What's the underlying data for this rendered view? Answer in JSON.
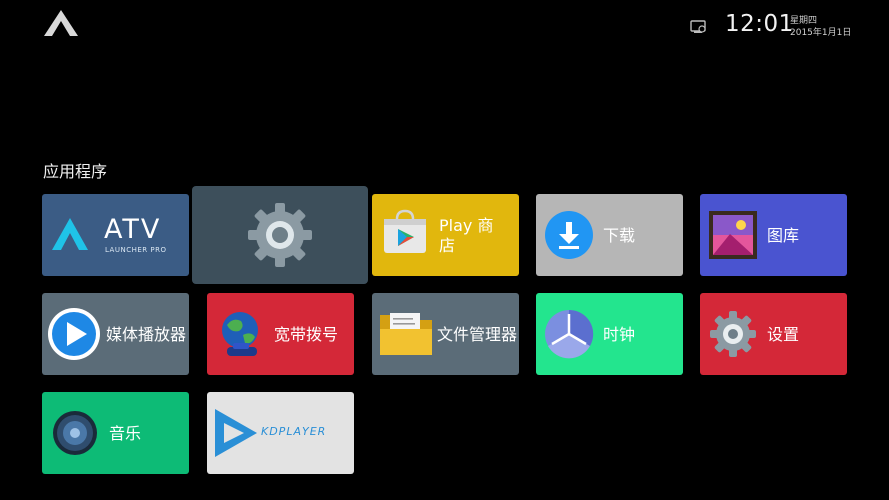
{
  "status_bar": {
    "time": "12:01",
    "weekday": "星期四",
    "date": "2015年1月1日"
  },
  "section": {
    "title": "应用程序"
  },
  "apps": {
    "atv": {
      "title": "ATV",
      "subtitle": "LAUNCHER PRO"
    },
    "play_store": {
      "line1": "Play 商",
      "line2": "店"
    },
    "download": {
      "label": "下载"
    },
    "gallery": {
      "label": "图库"
    },
    "media_player": {
      "label": "媒体播放器"
    },
    "broadband_dial": {
      "label": "宽带拨号"
    },
    "file_manager": {
      "label": "文件管理器"
    },
    "clock": {
      "label": "时钟"
    },
    "settings": {
      "label": "设置"
    },
    "music": {
      "label": "音乐"
    },
    "kdplayer": {
      "label": "KDPLAYER"
    }
  },
  "colors": {
    "background": "#000000",
    "atv": "#3b5c85",
    "focused": "#3d4f5b",
    "play_store": "#e1b70d",
    "download": "#b6b6b6",
    "gallery": "#4a54d0",
    "slate": "#5b6c78",
    "red": "#d42838",
    "clock": "#23e58e",
    "music": "#0dbb76",
    "kdplayer": "#e3e3e3"
  },
  "focused_app": "settings-shortcut"
}
